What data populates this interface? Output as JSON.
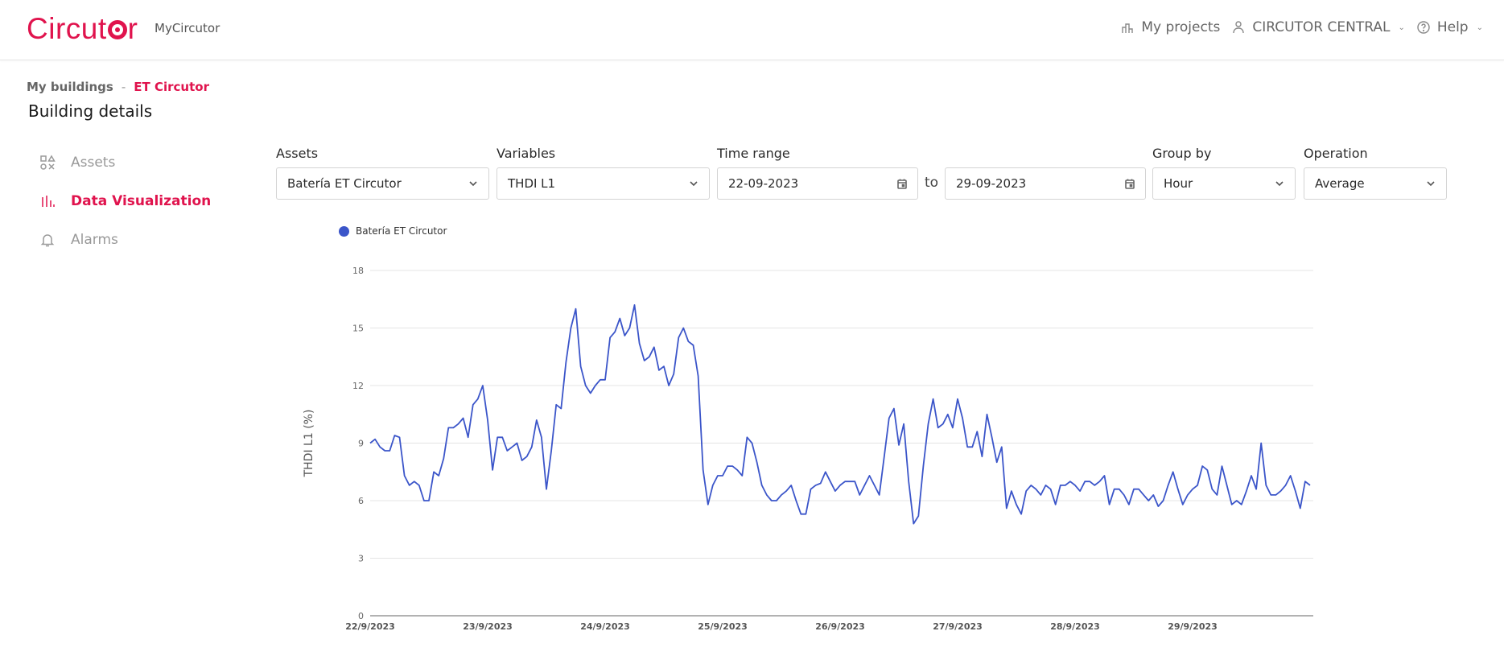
{
  "header": {
    "logo_text_pre": "Circut",
    "logo_text_post": "r",
    "app_name": "MyCircutor",
    "my_projects": "My projects",
    "account": "CIRCUTOR CENTRAL",
    "help": "Help"
  },
  "breadcrumb": {
    "parent": "My buildings",
    "separator": "-",
    "current": "ET Circutor"
  },
  "page_title": "Building details",
  "nav": {
    "items": [
      {
        "label": "Assets",
        "icon": "shapes-icon",
        "active": false
      },
      {
        "label": "Data Visualization",
        "icon": "bar-chart-icon",
        "active": true
      },
      {
        "label": "Alarms",
        "icon": "bell-icon",
        "active": false
      }
    ]
  },
  "filters": {
    "assets": {
      "label": "Assets",
      "value": "Batería ET Circutor"
    },
    "variables": {
      "label": "Variables",
      "value": "THDI L1"
    },
    "time_range": {
      "label": "Time range",
      "from": "22-09-2023",
      "to_label": "to",
      "to": "29-09-2023"
    },
    "group_by": {
      "label": "Group by",
      "value": "Hour"
    },
    "operation": {
      "label": "Operation",
      "value": "Average"
    }
  },
  "colors": {
    "brand": "#e0134d",
    "series": "#3b55c9"
  },
  "chart_data": {
    "type": "line",
    "title": "",
    "xlabel": "",
    "ylabel": "THDI L1 (%)",
    "ylim": [
      0,
      18
    ],
    "yticks": [
      0,
      3,
      6,
      9,
      12,
      15,
      18
    ],
    "grid": true,
    "legend": "top-left",
    "x_tick_labels": [
      "22/9/2023",
      "23/9/2023",
      "24/9/2023",
      "25/9/2023",
      "26/9/2023",
      "27/9/2023",
      "28/9/2023",
      "29/9/2023"
    ],
    "points_per_day": 24,
    "series": [
      {
        "name": "Batería ET Circutor",
        "values": [
          9.0,
          9.2,
          8.8,
          8.6,
          8.6,
          9.4,
          9.3,
          7.3,
          6.8,
          7.0,
          6.8,
          6.0,
          6.0,
          7.5,
          7.3,
          8.2,
          9.8,
          9.8,
          10.0,
          10.3,
          9.3,
          11.0,
          11.3,
          12.0,
          10.2,
          7.6,
          9.3,
          9.3,
          8.6,
          8.8,
          9.0,
          8.1,
          8.3,
          8.8,
          10.2,
          9.3,
          6.6,
          8.6,
          11.0,
          10.8,
          13.2,
          15.0,
          16.0,
          13.0,
          12.0,
          11.6,
          12.0,
          12.3,
          12.3,
          14.5,
          14.8,
          15.5,
          14.6,
          15.0,
          16.2,
          14.2,
          13.3,
          13.5,
          14.0,
          12.8,
          13.0,
          12.0,
          12.6,
          14.5,
          15.0,
          14.3,
          14.1,
          12.5,
          7.6,
          5.8,
          6.8,
          7.3,
          7.3,
          7.8,
          7.8,
          7.6,
          7.3,
          9.3,
          9.0,
          8.0,
          6.8,
          6.3,
          6.0,
          6.0,
          6.3,
          6.5,
          6.8,
          6.0,
          5.3,
          5.3,
          6.6,
          6.8,
          6.9,
          7.5,
          7.0,
          6.5,
          6.8,
          7.0,
          7.0,
          7.0,
          6.3,
          6.8,
          7.3,
          6.8,
          6.3,
          8.3,
          10.3,
          10.8,
          8.9,
          10.0,
          7.0,
          4.8,
          5.2,
          7.8,
          10.0,
          11.3,
          9.8,
          10.0,
          10.5,
          9.8,
          11.3,
          10.3,
          8.8,
          8.8,
          9.6,
          8.3,
          10.5,
          9.3,
          8.0,
          8.8,
          5.6,
          6.5,
          5.8,
          5.3,
          6.5,
          6.8,
          6.6,
          6.3,
          6.8,
          6.6,
          5.8,
          6.8,
          6.8,
          7.0,
          6.8,
          6.5,
          7.0,
          7.0,
          6.8,
          7.0,
          7.3,
          5.8,
          6.6,
          6.6,
          6.3,
          5.8,
          6.6,
          6.6,
          6.3,
          6.0,
          6.3,
          5.7,
          6.0,
          6.8,
          7.5,
          6.6,
          5.8,
          6.3,
          6.6,
          6.8,
          7.8,
          7.6,
          6.6,
          6.3,
          7.8,
          6.8,
          5.8,
          6.0,
          5.8,
          6.5,
          7.3,
          6.6,
          9.0,
          6.8,
          6.3,
          6.3,
          6.5,
          6.8,
          7.3,
          6.5,
          5.6,
          7.0,
          6.8
        ]
      }
    ]
  }
}
